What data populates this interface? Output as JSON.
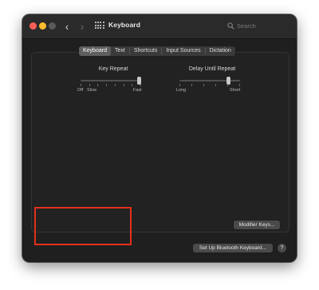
{
  "window": {
    "title": "Keyboard",
    "traffic_lights": {
      "close_color": "#ff5f57",
      "minimize_color": "#febc2e",
      "zoom_color": "#5a5a5a"
    },
    "nav": {
      "back_icon": "chevron-left-icon",
      "forward_icon": "chevron-right-icon",
      "back_glyph": "‹",
      "forward_glyph": "›",
      "grid_icon": "grid-icon"
    },
    "search": {
      "placeholder": "Search",
      "value": ""
    }
  },
  "tabs": [
    {
      "label": "Keyboard",
      "active": true
    },
    {
      "label": "Text",
      "active": false
    },
    {
      "label": "Shortcuts",
      "active": false
    },
    {
      "label": "Input Sources",
      "active": false
    },
    {
      "label": "Dictation",
      "active": false
    }
  ],
  "key_repeat": {
    "title": "Key Repeat",
    "labels": [
      "Off",
      "Slow",
      "Fast"
    ],
    "value_fraction": 1.0,
    "tick_count": 8
  },
  "delay_until_repeat": {
    "title": "Delay Until Repeat",
    "labels": [
      "Long",
      "Short"
    ],
    "value_fraction": 0.83,
    "tick_count": 6
  },
  "buttons": {
    "modifier_keys": "Modifier Keys...",
    "bluetooth": "Set Up Bluetooth Keyboard...",
    "help": "?"
  },
  "highlight_color": "#e3301b",
  "accent_dark_bg": "#1f1f1f"
}
